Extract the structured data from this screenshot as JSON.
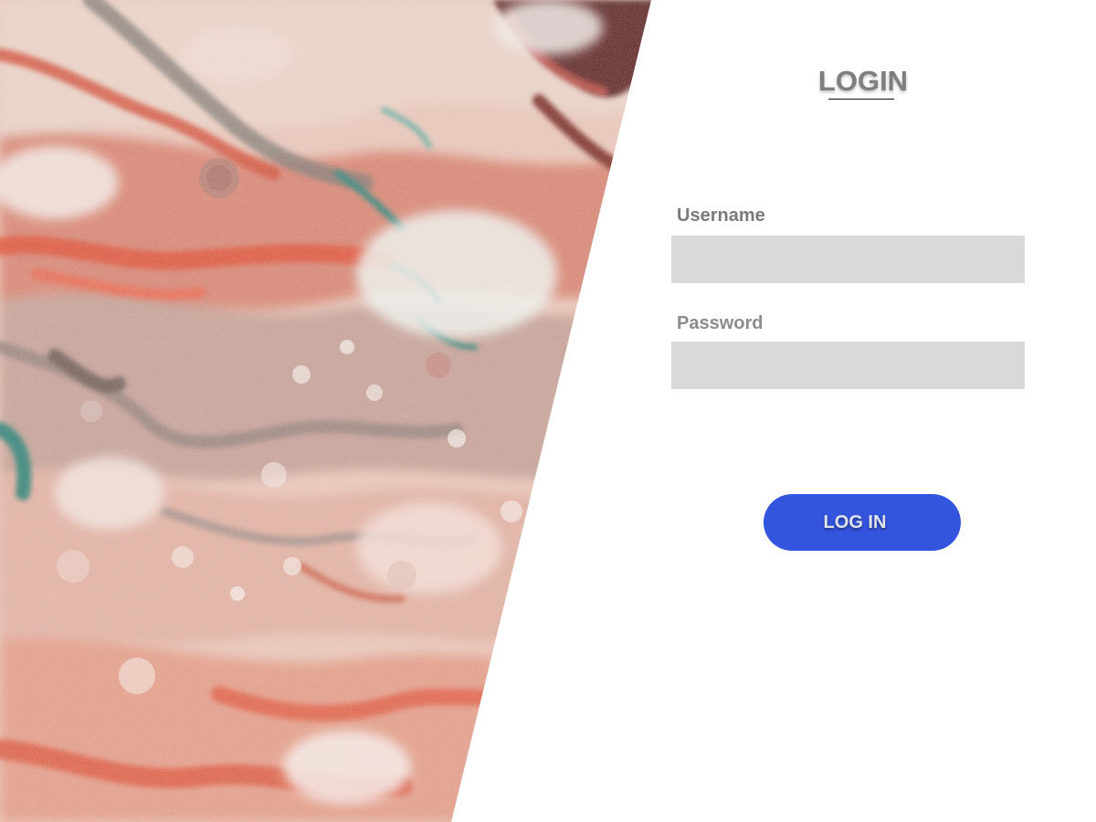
{
  "login": {
    "title": "LOGIN",
    "username_label": "Username",
    "username_value": "",
    "password_label": "Password",
    "password_value": "",
    "submit_label": "LOG IN"
  },
  "colors": {
    "button": "#3355de",
    "input_background": "#d9d9d9",
    "title": "#7f7f7f",
    "label": "#7a7a7a"
  },
  "decoration": {
    "left_panel": "marble-texture-image"
  }
}
